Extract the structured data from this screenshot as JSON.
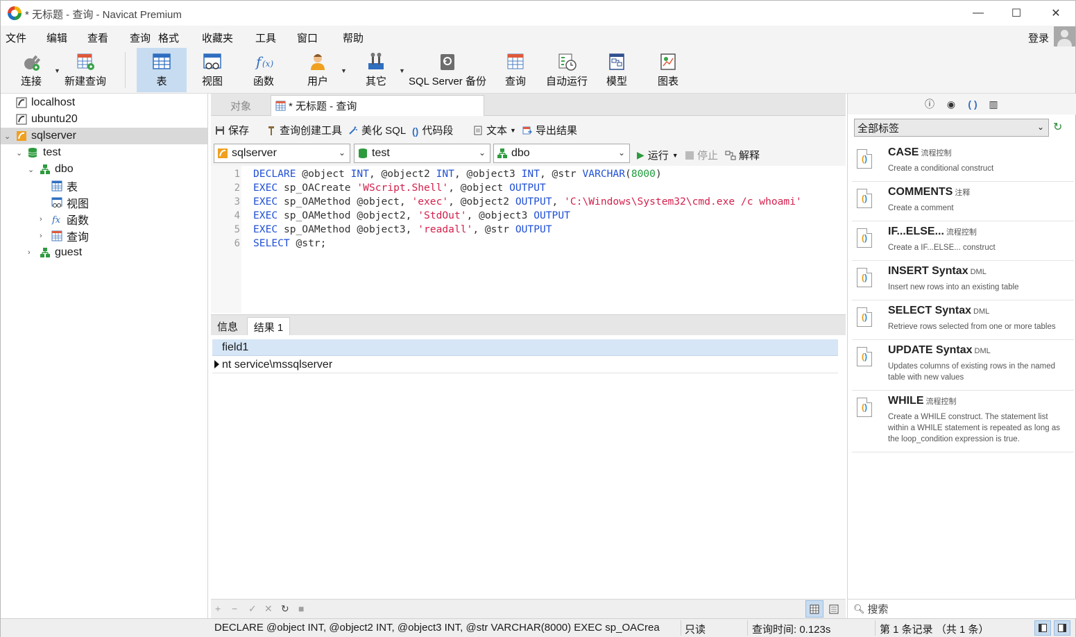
{
  "window": {
    "title": "* 无标题 - 查询 - Navicat Premium",
    "minimize": "—",
    "maximize": "☐",
    "close": "✕"
  },
  "menu": {
    "items": [
      "文件",
      "编辑",
      "查看",
      "查询",
      "格式",
      "收藏夹",
      "工具",
      "窗口",
      "帮助"
    ],
    "login": "登录"
  },
  "toolbar": {
    "items": [
      {
        "label": "连接",
        "icon": "plug-icon"
      },
      {
        "label": "新建查询",
        "icon": "new-query-icon"
      },
      {
        "label": "表",
        "icon": "table-icon",
        "active": true
      },
      {
        "label": "视图",
        "icon": "view-icon"
      },
      {
        "label": "函数",
        "icon": "function-icon"
      },
      {
        "label": "用户",
        "icon": "user-icon"
      },
      {
        "label": "其它",
        "icon": "tools-icon"
      },
      {
        "label": "SQL Server 备份",
        "icon": "backup-icon"
      },
      {
        "label": "查询",
        "icon": "query-icon"
      },
      {
        "label": "自动运行",
        "icon": "schedule-icon"
      },
      {
        "label": "模型",
        "icon": "model-icon"
      },
      {
        "label": "图表",
        "icon": "chart-icon"
      }
    ]
  },
  "tree": {
    "items": [
      {
        "label": "localhost",
        "icon": "server-icon"
      },
      {
        "label": "ubuntu20",
        "icon": "server-icon"
      },
      {
        "label": "sqlserver",
        "icon": "sqlserver-icon"
      },
      {
        "label": "test",
        "icon": "database-icon"
      },
      {
        "label": "dbo",
        "icon": "schema-icon"
      },
      {
        "label": "表",
        "icon": "table-icon"
      },
      {
        "label": "视图",
        "icon": "view-icon"
      },
      {
        "label": "函数",
        "icon": "function-icon"
      },
      {
        "label": "查询",
        "icon": "query-icon"
      },
      {
        "label": "guest",
        "icon": "schema-icon"
      }
    ]
  },
  "tabs": {
    "objects": "对象",
    "query": "* 无标题 - 查询"
  },
  "query_toolbar": {
    "save": "保存",
    "builder": "查询创建工具",
    "beautify": "美化 SQL",
    "snippet": "代码段",
    "text": "文本",
    "export": "导出结果"
  },
  "selectors": {
    "connection": "sqlserver",
    "database": "test",
    "schema": "dbo",
    "run": "运行",
    "stop": "停止",
    "explain": "解释"
  },
  "editor": {
    "line_numbers": [
      "1",
      "2",
      "3",
      "4",
      "5",
      "6"
    ]
  },
  "results": {
    "tab_info": "信息",
    "tab_result": "结果 1",
    "column": "field1",
    "value": "nt service\\mssqlserver"
  },
  "grid_footer": {
    "add": "+",
    "remove": "−",
    "apply": "✓",
    "discard": "✕",
    "refresh": "↻",
    "stop": "■"
  },
  "right_panel": {
    "tag_select": "全部标签",
    "snippets": [
      {
        "title": "CASE",
        "tag": "流程控制",
        "desc": "Create a conditional construct"
      },
      {
        "title": "COMMENTS",
        "tag": "注释",
        "desc": "Create a comment"
      },
      {
        "title": "IF...ELSE...",
        "tag": "流程控制",
        "desc": "Create a IF...ELSE... construct"
      },
      {
        "title": "INSERT Syntax",
        "tag": "DML",
        "desc": "Insert new rows into an existing table"
      },
      {
        "title": "SELECT Syntax",
        "tag": "DML",
        "desc": "Retrieve rows selected from one or more tables"
      },
      {
        "title": "UPDATE Syntax",
        "tag": "DML",
        "desc": "Updates columns of existing rows in the named table with new values"
      },
      {
        "title": "WHILE",
        "tag": "流程控制",
        "desc": "Create a WHILE construct. The statement list within a WHILE statement is repeated as long as the loop_condition expression is true."
      }
    ],
    "search_placeholder": "搜索"
  },
  "status": {
    "sql": "DECLARE @object INT, @object2 INT, @object3 INT, @str VARCHAR(8000) EXEC sp_OACrea",
    "readonly": "只读",
    "query_time": "查询时间: 0.123s",
    "records": "第 1 条记录 （共 1 条）"
  }
}
